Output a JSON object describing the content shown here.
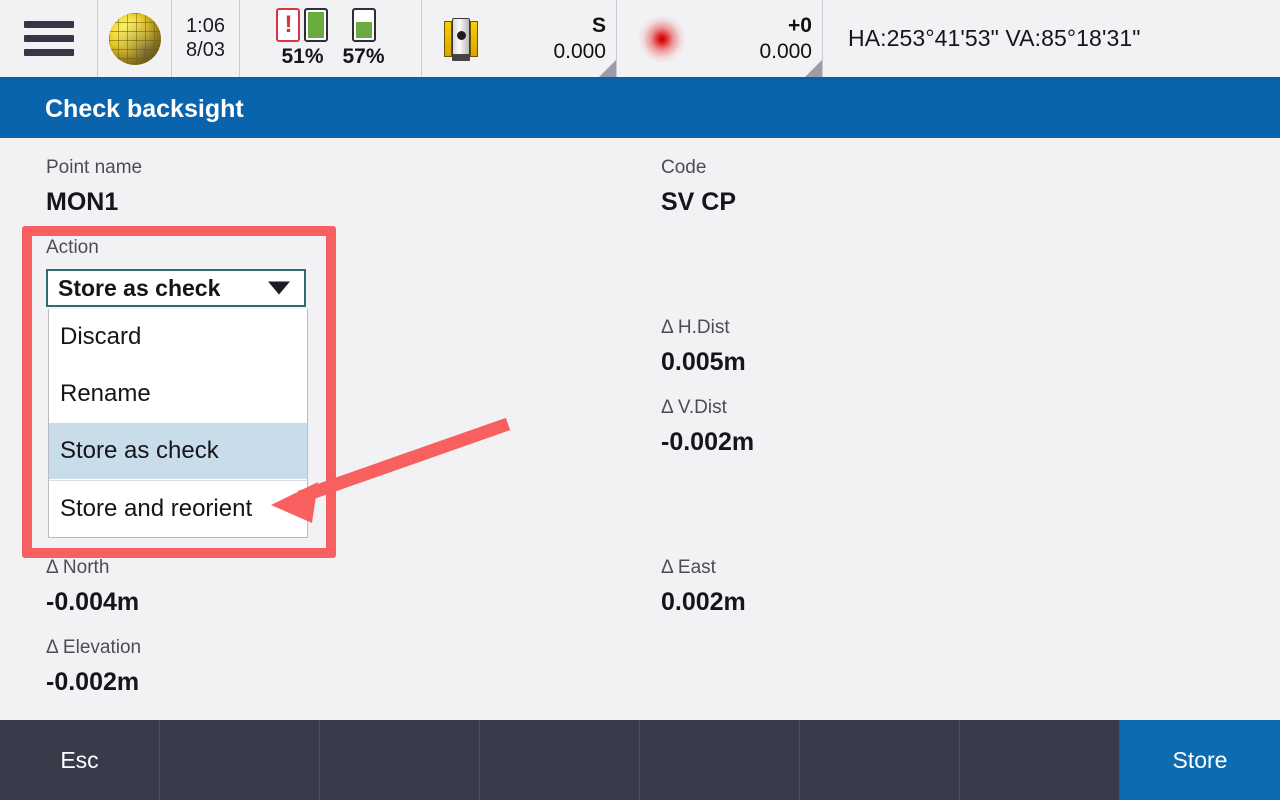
{
  "statusbar": {
    "menu_icon": "hamburger-menu-icon",
    "globe_icon": "globe-icon",
    "time": "1:06",
    "date": "8/03",
    "battery_left": {
      "percent": "51%",
      "alert_icon": "battery-alert-icon",
      "second_icon": "battery-full-icon"
    },
    "battery_right": {
      "percent": "57%",
      "icon": "battery-half-icon"
    },
    "instrument": {
      "icon": "total-station-icon",
      "mode": "S",
      "value": "0.000"
    },
    "target": {
      "icon": "laser-pointer-icon",
      "prism": "+0",
      "value": "0.000"
    },
    "angles": "HA:253°41'53\"  VA:85°18'31\""
  },
  "title": "Check backsight",
  "form": {
    "point_name_label": "Point name",
    "point_name_value": "MON1",
    "code_label": "Code",
    "code_value": "SV CP",
    "action_label": "Action",
    "action_selected": "Store as check",
    "action_options": [
      "Discard",
      "Rename",
      "Store as check",
      "Store and reorient"
    ],
    "hdist_label": "Δ H.Dist",
    "hdist_value": "0.005m",
    "vdist_label": "Δ V.Dist",
    "vdist_value": "-0.002m",
    "north_label": "Δ North",
    "north_value": "-0.004m",
    "east_label": "Δ East",
    "east_value": "0.002m",
    "elevation_label": "Δ Elevation",
    "elevation_value": "-0.002m"
  },
  "footer": {
    "esc_label": "Esc",
    "store_label": "Store",
    "empty_slots": 6
  },
  "colors": {
    "title_bar": "#0a64ad",
    "accent_button": "#0d6cb0",
    "footer": "#393a4a",
    "annotation": "#f7605f",
    "selected_row": "#c9dcea",
    "combo_border": "#2f6b73"
  }
}
